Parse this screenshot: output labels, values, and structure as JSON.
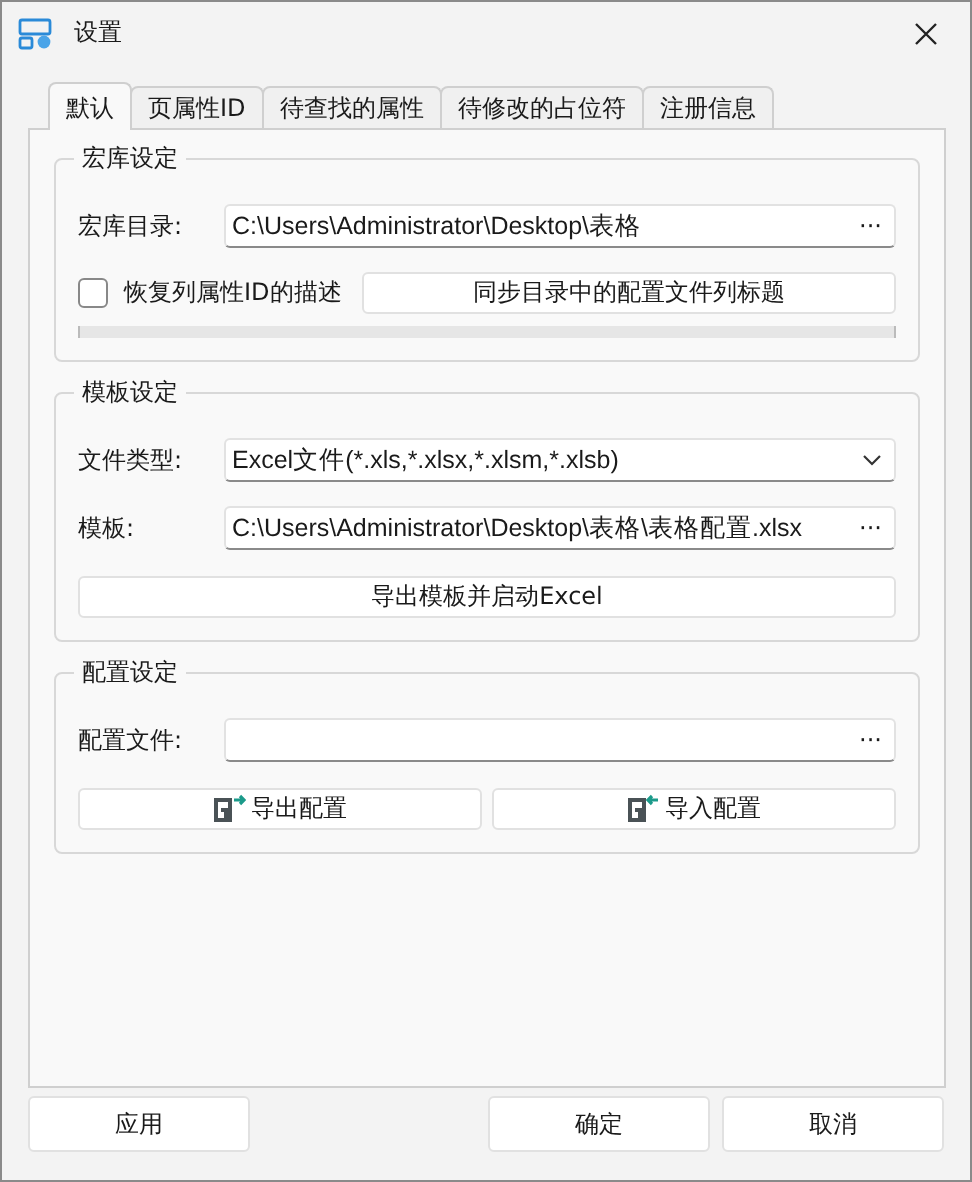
{
  "window": {
    "title": "设置"
  },
  "tabs": [
    {
      "label": "默认",
      "selected": true
    },
    {
      "label": "页属性ID",
      "selected": false
    },
    {
      "label": "待查找的属性",
      "selected": false
    },
    {
      "label": "待修改的占位符",
      "selected": false
    },
    {
      "label": "注册信息",
      "selected": false
    }
  ],
  "macro_group": {
    "title": "宏库设定",
    "dir_label": "宏库目录:",
    "dir_value": "C:\\Users\\Administrator\\Desktop\\表格",
    "browse": "···",
    "restore_checkbox": {
      "label": "恢复列属性ID的描述",
      "checked": false
    },
    "sync_button": "同步目录中的配置文件列标题",
    "progress": {
      "level": 0
    }
  },
  "template_group": {
    "title": "模板设定",
    "type_label": "文件类型:",
    "type_value": "Excel文件(*.xls,*.xlsx,*.xlsm,*.xlsb)",
    "template_label": "模板:",
    "template_value": "C:\\Users\\Administrator\\Desktop\\表格\\表格配置.xlsx",
    "browse": "···",
    "export_button": "导出模板并启动Excel"
  },
  "config_group": {
    "title": "配置设定",
    "file_label": "配置文件:",
    "browse": "···",
    "buttons": [
      {
        "label": "导出配置",
        "kind": "export"
      },
      {
        "label": "导入配置",
        "kind": "import"
      }
    ]
  },
  "footer_buttons": [
    {
      "label": "应用"
    },
    {
      "label": "确定"
    },
    {
      "label": "取消"
    }
  ]
}
